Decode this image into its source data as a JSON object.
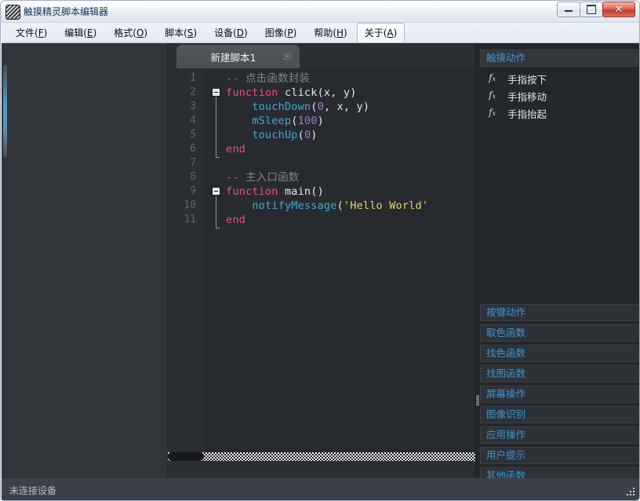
{
  "window": {
    "title": "触摸精灵脚本编辑器",
    "app_icon": "striped-app-icon",
    "minimize_label": "最小化",
    "maximize_label": "最大化",
    "close_label": "✕"
  },
  "menubar": {
    "items": [
      {
        "text": "文件(F)",
        "pre": "文件(",
        "accel": "F",
        "post": ")",
        "active": false
      },
      {
        "text": "编辑(E)",
        "pre": "编辑(",
        "accel": "E",
        "post": ")",
        "active": false
      },
      {
        "text": "格式(O)",
        "pre": "格式(",
        "accel": "O",
        "post": ")",
        "active": false
      },
      {
        "text": "脚本(S)",
        "pre": "脚本(",
        "accel": "S",
        "post": ")",
        "active": false
      },
      {
        "text": "设备(D)",
        "pre": "设备(",
        "accel": "D",
        "post": ")",
        "active": false
      },
      {
        "text": "图像(P)",
        "pre": "图像(",
        "accel": "P",
        "post": ")",
        "active": false
      },
      {
        "text": "帮助(H)",
        "pre": "帮助(",
        "accel": "H",
        "post": ")",
        "active": false
      },
      {
        "text": "关于(A)",
        "pre": "关于(",
        "accel": "A",
        "post": ")",
        "active": true
      }
    ]
  },
  "editor": {
    "tab_label": "新建脚本1",
    "tab_close": "×",
    "line_numbers": [
      "1",
      "2",
      "3",
      "4",
      "5",
      "6",
      "7",
      "8",
      "9",
      "10",
      "11"
    ],
    "lines": [
      {
        "n": 1,
        "tokens": [
          {
            "t": "comment",
            "v": "-- 点击函数封装"
          }
        ]
      },
      {
        "n": 2,
        "tokens": [
          {
            "t": "kw",
            "v": "function"
          },
          {
            "t": "punc",
            "v": " "
          },
          {
            "t": "fname",
            "v": "click"
          },
          {
            "t": "punc",
            "v": "(x, y)"
          }
        ]
      },
      {
        "n": 3,
        "tokens": [
          {
            "t": "punc",
            "v": "    "
          },
          {
            "t": "fn",
            "v": "touchDown"
          },
          {
            "t": "punc",
            "v": "("
          },
          {
            "t": "num",
            "v": "0"
          },
          {
            "t": "punc",
            "v": ", x, y)"
          }
        ]
      },
      {
        "n": 4,
        "tokens": [
          {
            "t": "punc",
            "v": "    "
          },
          {
            "t": "fn",
            "v": "mSleep"
          },
          {
            "t": "punc",
            "v": "("
          },
          {
            "t": "num",
            "v": "100"
          },
          {
            "t": "punc",
            "v": ")"
          }
        ]
      },
      {
        "n": 5,
        "tokens": [
          {
            "t": "punc",
            "v": "    "
          },
          {
            "t": "fn",
            "v": "touchUp"
          },
          {
            "t": "punc",
            "v": "("
          },
          {
            "t": "num",
            "v": "0"
          },
          {
            "t": "punc",
            "v": ")"
          }
        ]
      },
      {
        "n": 6,
        "tokens": [
          {
            "t": "kw",
            "v": "end"
          }
        ]
      },
      {
        "n": 7,
        "tokens": []
      },
      {
        "n": 8,
        "tokens": [
          {
            "t": "comment",
            "v": "-- 主入口函数"
          }
        ]
      },
      {
        "n": 9,
        "tokens": [
          {
            "t": "kw",
            "v": "function"
          },
          {
            "t": "punc",
            "v": " "
          },
          {
            "t": "fname",
            "v": "main"
          },
          {
            "t": "punc",
            "v": "()"
          }
        ]
      },
      {
        "n": 10,
        "tokens": [
          {
            "t": "punc",
            "v": "    "
          },
          {
            "t": "fn",
            "v": "notifyMessage"
          },
          {
            "t": "punc",
            "v": "("
          },
          {
            "t": "str",
            "v": "'Hello World'"
          }
        ]
      },
      {
        "n": 11,
        "tokens": [
          {
            "t": "kw",
            "v": "end"
          }
        ]
      }
    ],
    "fold_markers": [
      2,
      9
    ]
  },
  "right_panel": {
    "sections": [
      {
        "title": "触摸动作",
        "open": true,
        "items": [
          {
            "icon": "fx-icon",
            "label": "手指按下"
          },
          {
            "icon": "fx-icon",
            "label": "手指移动"
          },
          {
            "icon": "fx-icon",
            "label": "手指抬起"
          }
        ]
      },
      {
        "title": "按键动作",
        "open": false,
        "items": []
      },
      {
        "title": "取色函数",
        "open": false,
        "items": []
      },
      {
        "title": "找色函数",
        "open": false,
        "items": []
      },
      {
        "title": "找图函数",
        "open": false,
        "items": []
      },
      {
        "title": "屏幕操作",
        "open": false,
        "items": []
      },
      {
        "title": "图像识别",
        "open": false,
        "items": []
      },
      {
        "title": "应用操作",
        "open": false,
        "items": []
      },
      {
        "title": "用户提示",
        "open": false,
        "items": []
      },
      {
        "title": "其他函数",
        "open": false,
        "items": []
      }
    ]
  },
  "statusbar": {
    "text": "未连接设备"
  },
  "colors": {
    "accent_blue": "#3d95d0",
    "keyword": "#ec4d8a",
    "function": "#3fa9d6",
    "number": "#a475d6",
    "string": "#e8d36c",
    "comment": "#7f8487",
    "editor_bg": "#272b2f",
    "panel_bg": "#23272b",
    "close_red": "#c23c2c"
  }
}
